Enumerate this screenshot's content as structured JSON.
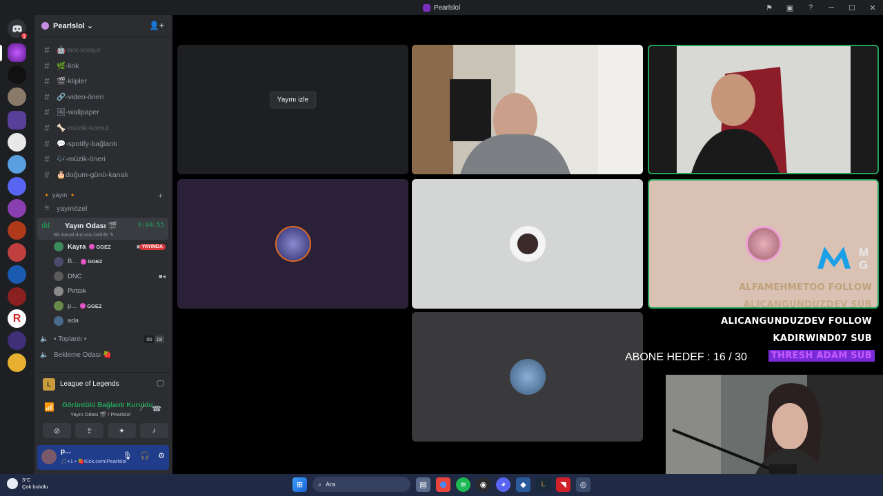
{
  "window": {
    "title": "Pearlslol",
    "controls": [
      "⚑",
      "▣",
      "?",
      "─",
      "☐",
      "✕"
    ]
  },
  "servers": {
    "home_badge": "1"
  },
  "server_header": {
    "name": "Pearlslol ⌄",
    "add_user_icon": "add-user-icon"
  },
  "channels": [
    {
      "label": "🤖-bot-komut",
      "muted": true
    },
    {
      "label": "🌿-link",
      "muted": false
    },
    {
      "label": "🎬-klipler",
      "muted": false
    },
    {
      "label": "🔗-video-öneri",
      "muted": false
    },
    {
      "label": "🖼-wallpaper",
      "muted": false
    },
    {
      "label": "🦴-müzik-komut",
      "muted": true
    },
    {
      "label": "💬-spotify-bağlantı",
      "muted": false
    },
    {
      "label": "🎶-müzik-öneri",
      "muted": false
    },
    {
      "label": "🎂doğum-günü-kanalı",
      "muted": false
    }
  ],
  "category": {
    "label": "🔸 yayın 🔸",
    "sub": "yayınözel"
  },
  "active_voice": {
    "name": "Yayın Odası 🎬",
    "time": "6:04:55",
    "status": "Bir kanal durumu belirle ✎"
  },
  "voice_users": [
    {
      "name": "Kayra",
      "tag": "GGEZ",
      "cam": true,
      "live": "YAYINDA"
    },
    {
      "name": "B...",
      "tag": "GGEZ",
      "cam": false,
      "live": ""
    },
    {
      "name": "DNC",
      "tag": "",
      "cam2": true,
      "live": ""
    },
    {
      "name": "Pırtcık",
      "tag": "",
      "cam": false,
      "live": ""
    },
    {
      "name": "p...",
      "tag": "GGEZ",
      "cam": false,
      "live": ""
    },
    {
      "name": "ada",
      "tag": "",
      "cam": false,
      "live": ""
    }
  ],
  "other_voice": [
    {
      "label": "• Toplantı •",
      "count_a": "00",
      "count_b": "18"
    },
    {
      "label": "Bekleme Odası 🍓",
      "count_a": "",
      "count_b": ""
    }
  ],
  "activity": {
    "game": "League of Legends",
    "game_icon": "L"
  },
  "connection": {
    "status": "Görüntülü Bağlantı Kuruldu",
    "channel": "Yayın Odası 🎬 / Pearlslol"
  },
  "user_panel": {
    "name": "p...",
    "status": "🎵+1 • 🍓Kick.com/Pearlslol"
  },
  "stage": {
    "watch_label": "Yayını izle"
  },
  "overlay": {
    "feed": [
      {
        "text": "ALFAMEHMETOO  FOLLOW",
        "color": "#bfa27a"
      },
      {
        "text": "ALICANGUNDUZDEV  SUB",
        "color": "#bfa27a"
      },
      {
        "text": "ALICANGUNDUZDEV  FOLLOW",
        "color": "#ffffff"
      },
      {
        "text": "KADIRWIND07  SUB",
        "color": "#ffffff"
      },
      {
        "text": "THRESH  ADAM  SUB",
        "color": "#c45bff"
      }
    ],
    "logo_letters": "M\nG",
    "abone": "ABONE HEDEF : 16 / 30"
  },
  "taskbar": {
    "temp": "3°C",
    "weather": "Çok bulutlu",
    "search_placeholder": "Ara"
  },
  "colors": {
    "accent": "#5865f2",
    "live": "#da373c",
    "online": "#23a559",
    "thresh_bg": "#7a2bd8"
  }
}
